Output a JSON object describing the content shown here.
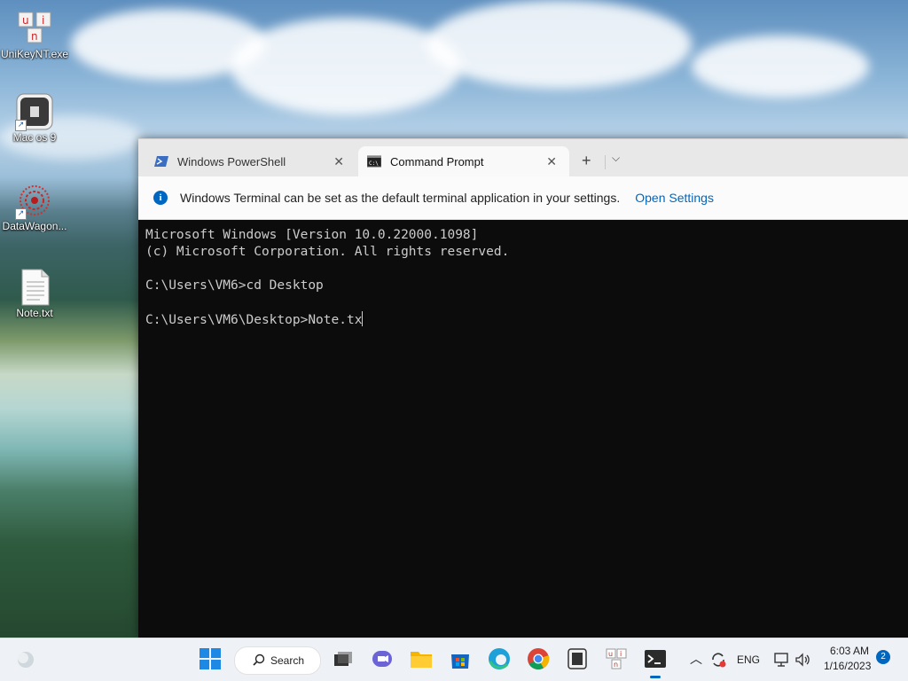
{
  "desktop": {
    "icons": [
      {
        "label": "UniKeyNT.exe",
        "icon": "unikey-icon"
      },
      {
        "label": "Mac os 9",
        "icon": "vm-icon"
      },
      {
        "label": "DataWagon...",
        "icon": "datawagon-icon"
      },
      {
        "label": "Note.txt",
        "icon": "text-file-icon"
      }
    ]
  },
  "terminal": {
    "tabs": [
      {
        "label": "Windows PowerShell",
        "icon": "powershell-icon",
        "active": false
      },
      {
        "label": "Command Prompt",
        "icon": "cmd-icon",
        "active": true
      }
    ],
    "infobar": {
      "message": "Windows Terminal can be set as the default terminal application in your settings.",
      "link": "Open Settings"
    },
    "console_lines": [
      "Microsoft Windows [Version 10.0.22000.1098]",
      "(c) Microsoft Corporation. All rights reserved.",
      "",
      "C:\\Users\\VM6>cd Desktop",
      "",
      "C:\\Users\\VM6\\Desktop>Note.tx"
    ]
  },
  "taskbar": {
    "search_label": "Search",
    "apps": [
      "start-icon",
      "task-view-icon",
      "teams-chat-icon",
      "file-explorer-icon",
      "microsoft-store-icon",
      "edge-icon",
      "chrome-icon",
      "vm-app-icon",
      "unikey-app-icon",
      "terminal-icon"
    ],
    "tray": {
      "language": "ENG",
      "time": "6:03 AM",
      "date": "1/16/2023",
      "notification_count": "2"
    }
  },
  "colors": {
    "accent": "#0067c0",
    "console_bg": "#0c0c0c",
    "console_fg": "#cccccc"
  }
}
